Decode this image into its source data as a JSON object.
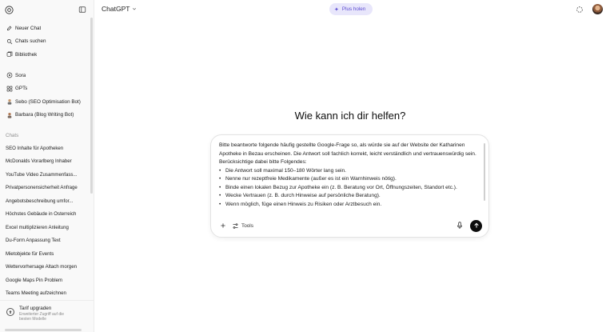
{
  "sidebar": {
    "nav": [
      {
        "label": "Neuer Chat",
        "icon": "edit-icon"
      },
      {
        "label": "Chats suchen",
        "icon": "search-icon"
      },
      {
        "label": "Bibliothek",
        "icon": "library-icon"
      }
    ],
    "apps": [
      {
        "label": "Sora",
        "icon": "sora-icon"
      },
      {
        "label": "GPTs",
        "icon": "grid-icon"
      },
      {
        "label": "Sebo (SEO Optimisation Bot)",
        "icon": "bot-avatar-icon"
      },
      {
        "label": "Barbara (Blog Writing Bot)",
        "icon": "bot-avatar-icon"
      }
    ],
    "chats_heading": "Chats",
    "chats": [
      "SEO Inhalte für Apotheken",
      "McDonalds Vorarlberg Inhaber",
      "YouTube Video Zusammenfass...",
      "Privatpersonensicherheit Anfrage",
      "Angebotsbeschreibung umfor...",
      "Höchstes Gebäude in Österreich",
      "Excel multiplizieren Anleitung",
      "Du-Form Anpassung Text",
      "Mietobjekte für Events",
      "Wettervorhersage Altach morgen",
      "Google Maps Pin Problem",
      "Teams Meeting aufzeichnen"
    ],
    "upgrade": {
      "title": "Tarif upgraden",
      "subtitle": "Erweiterter Zugriff auf die besten Modelle"
    }
  },
  "header": {
    "model": "ChatGPT",
    "plus_button": "Plus holen"
  },
  "main": {
    "greeting": "Wie kann ich dir helfen?"
  },
  "composer": {
    "intro": "Bitte beantworte folgende häufig gestellte Google-Frage so, als würde sie auf der Website der Katharinen Apotheke in Bezau erscheinen. Die Antwort soll fachlich korrekt, leicht verständlich und vertrauenswürdig sein.",
    "consider": "Berücksichtige dabei bitte Folgendes:",
    "bullets": [
      "Die Antwort soll maximal 150–180 Wörter lang sein.",
      "Nenne nur rezeptfreie Medikamente (außer es ist ein Warnhinweis nötig).",
      "Binde einen lokalen Bezug zur Apotheke ein (z. B. Beratung vor Ort, Öffnungszeiten, Standort etc.).",
      "Wecke Vertrauen (z. B. durch Hinweise auf persönliche Beratung).",
      "Wenn möglich, füge einen Hinweis zu Risiken oder Arztbesuch ein."
    ],
    "tools_label": "Tools"
  },
  "colors": {
    "accent_plus_bg": "#e8e6fb",
    "accent_plus_text": "#5b4bd1",
    "send_button": "#0d0d0d"
  }
}
